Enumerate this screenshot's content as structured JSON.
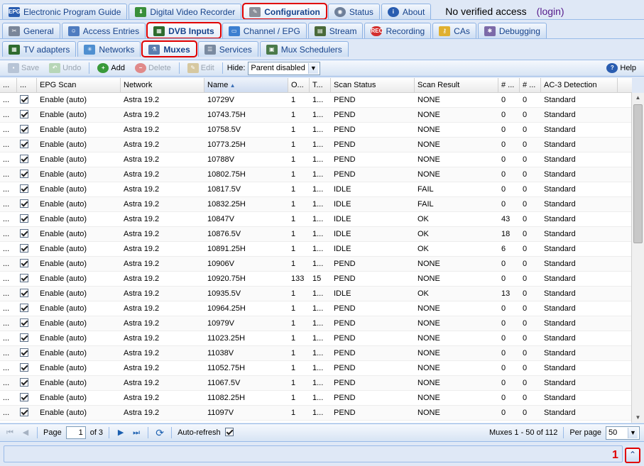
{
  "tabs_main": [
    {
      "label": "Electronic Program Guide",
      "icon": "epg-icon"
    },
    {
      "label": "Digital Video Recorder",
      "icon": "dvr-download-icon"
    },
    {
      "label": "Configuration",
      "icon": "wrench-icon"
    },
    {
      "label": "Status",
      "icon": "eye-icon"
    },
    {
      "label": "About",
      "icon": "info-icon"
    }
  ],
  "access_text": "No verified access",
  "login_text": "(login)",
  "tabs_config": [
    {
      "label": "General",
      "icon": "tools-icon"
    },
    {
      "label": "Access Entries",
      "icon": "users-icon"
    },
    {
      "label": "DVB Inputs",
      "icon": "dvb-icon"
    },
    {
      "label": "Channel / EPG",
      "icon": "tv-icon"
    },
    {
      "label": "Stream",
      "icon": "film-icon"
    },
    {
      "label": "Recording",
      "icon": "rec-icon"
    },
    {
      "label": "CAs",
      "icon": "key-icon"
    },
    {
      "label": "Debugging",
      "icon": "bug-icon"
    }
  ],
  "tabs_dvb": [
    {
      "label": "TV adapters",
      "icon": "card-icon"
    },
    {
      "label": "Networks",
      "icon": "antenna-icon"
    },
    {
      "label": "Muxes",
      "icon": "satellite-icon"
    },
    {
      "label": "Services",
      "icon": "services-icon"
    },
    {
      "label": "Mux Schedulers",
      "icon": "calendar-icon"
    }
  ],
  "toolbar": {
    "save": "Save",
    "undo": "Undo",
    "add": "Add",
    "delete": "Delete",
    "edit": "Edit",
    "hide_label": "Hide:",
    "hide_value": "Parent disabled",
    "help": "Help"
  },
  "columns": [
    "...",
    "...",
    "EPG Scan",
    "Network",
    "Name",
    "O...",
    "T...",
    "Scan Status",
    "Scan Result",
    "# ...",
    "# ...",
    "AC-3 Detection"
  ],
  "rows": [
    [
      "...",
      "Enable (auto)",
      "Astra 19.2",
      "10729V",
      "1",
      "1...",
      "PEND",
      "NONE",
      "0",
      "0",
      "Standard"
    ],
    [
      "...",
      "Enable (auto)",
      "Astra 19.2",
      "10743.75H",
      "1",
      "1...",
      "PEND",
      "NONE",
      "0",
      "0",
      "Standard"
    ],
    [
      "...",
      "Enable (auto)",
      "Astra 19.2",
      "10758.5V",
      "1",
      "1...",
      "PEND",
      "NONE",
      "0",
      "0",
      "Standard"
    ],
    [
      "...",
      "Enable (auto)",
      "Astra 19.2",
      "10773.25H",
      "1",
      "1...",
      "PEND",
      "NONE",
      "0",
      "0",
      "Standard"
    ],
    [
      "...",
      "Enable (auto)",
      "Astra 19.2",
      "10788V",
      "1",
      "1...",
      "PEND",
      "NONE",
      "0",
      "0",
      "Standard"
    ],
    [
      "...",
      "Enable (auto)",
      "Astra 19.2",
      "10802.75H",
      "1",
      "1...",
      "PEND",
      "NONE",
      "0",
      "0",
      "Standard"
    ],
    [
      "...",
      "Enable (auto)",
      "Astra 19.2",
      "10817.5V",
      "1",
      "1...",
      "IDLE",
      "FAIL",
      "0",
      "0",
      "Standard"
    ],
    [
      "...",
      "Enable (auto)",
      "Astra 19.2",
      "10832.25H",
      "1",
      "1...",
      "IDLE",
      "FAIL",
      "0",
      "0",
      "Standard"
    ],
    [
      "...",
      "Enable (auto)",
      "Astra 19.2",
      "10847V",
      "1",
      "1...",
      "IDLE",
      "OK",
      "43",
      "0",
      "Standard"
    ],
    [
      "...",
      "Enable (auto)",
      "Astra 19.2",
      "10876.5V",
      "1",
      "1...",
      "IDLE",
      "OK",
      "18",
      "0",
      "Standard"
    ],
    [
      "...",
      "Enable (auto)",
      "Astra 19.2",
      "10891.25H",
      "1",
      "1...",
      "IDLE",
      "OK",
      "6",
      "0",
      "Standard"
    ],
    [
      "...",
      "Enable (auto)",
      "Astra 19.2",
      "10906V",
      "1",
      "1...",
      "PEND",
      "NONE",
      "0",
      "0",
      "Standard"
    ],
    [
      "...",
      "Enable (auto)",
      "Astra 19.2",
      "10920.75H",
      "133",
      "15",
      "PEND",
      "NONE",
      "0",
      "0",
      "Standard"
    ],
    [
      "...",
      "Enable (auto)",
      "Astra 19.2",
      "10935.5V",
      "1",
      "1...",
      "IDLE",
      "OK",
      "13",
      "0",
      "Standard"
    ],
    [
      "...",
      "Enable (auto)",
      "Astra 19.2",
      "10964.25H",
      "1",
      "1...",
      "PEND",
      "NONE",
      "0",
      "0",
      "Standard"
    ],
    [
      "...",
      "Enable (auto)",
      "Astra 19.2",
      "10979V",
      "1",
      "1...",
      "PEND",
      "NONE",
      "0",
      "0",
      "Standard"
    ],
    [
      "...",
      "Enable (auto)",
      "Astra 19.2",
      "11023.25H",
      "1",
      "1...",
      "PEND",
      "NONE",
      "0",
      "0",
      "Standard"
    ],
    [
      "...",
      "Enable (auto)",
      "Astra 19.2",
      "11038V",
      "1",
      "1...",
      "PEND",
      "NONE",
      "0",
      "0",
      "Standard"
    ],
    [
      "...",
      "Enable (auto)",
      "Astra 19.2",
      "11052.75H",
      "1",
      "1...",
      "PEND",
      "NONE",
      "0",
      "0",
      "Standard"
    ],
    [
      "...",
      "Enable (auto)",
      "Astra 19.2",
      "11067.5V",
      "1",
      "1...",
      "PEND",
      "NONE",
      "0",
      "0",
      "Standard"
    ],
    [
      "...",
      "Enable (auto)",
      "Astra 19.2",
      "11082.25H",
      "1",
      "1...",
      "PEND",
      "NONE",
      "0",
      "0",
      "Standard"
    ],
    [
      "...",
      "Enable (auto)",
      "Astra 19.2",
      "11097V",
      "1",
      "1...",
      "PEND",
      "NONE",
      "0",
      "0",
      "Standard"
    ]
  ],
  "pager": {
    "page_label": "Page",
    "page_value": "1",
    "of_label": "of 3",
    "auto_refresh": "Auto-refresh",
    "display_info": "Muxes 1 - 50 of 112",
    "per_page_label": "Per page",
    "per_page_value": "50"
  },
  "badge": "1",
  "colors": {
    "accent": "#15428b",
    "highlight": "#e00000",
    "panel": "#dfe8f6"
  }
}
